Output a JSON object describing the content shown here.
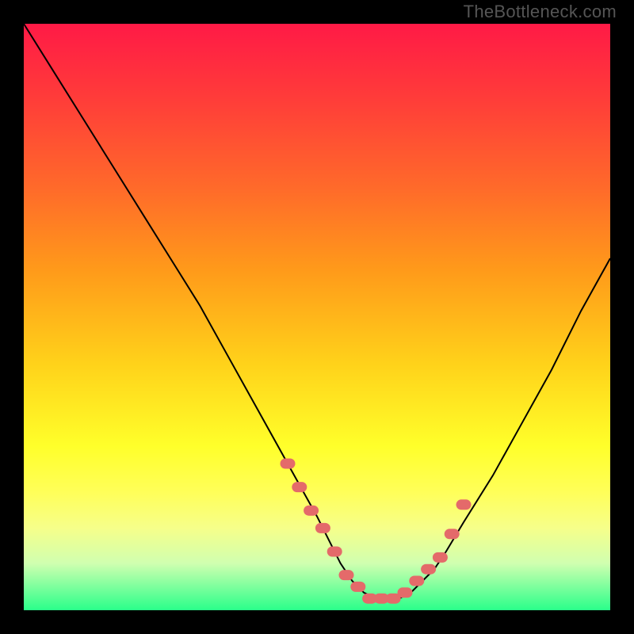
{
  "watermark": "TheBottleneck.com",
  "colors": {
    "background": "#000000",
    "gradient_top": "#ff1a46",
    "gradient_bottom": "#2aff8a",
    "curve": "#000000",
    "marker": "#e46a6a"
  },
  "chart_data": {
    "type": "line",
    "title": "",
    "xlabel": "",
    "ylabel": "",
    "xlim": [
      0,
      100
    ],
    "ylim": [
      0,
      100
    ],
    "grid": false,
    "legend": false,
    "series": [
      {
        "name": "bottleneck-curve",
        "x": [
          0,
          5,
          10,
          15,
          20,
          25,
          30,
          35,
          40,
          45,
          50,
          52,
          54,
          56,
          58,
          60,
          62,
          64,
          66,
          68,
          70,
          72,
          75,
          80,
          85,
          90,
          95,
          100
        ],
        "values": [
          100,
          92,
          84,
          76,
          68,
          60,
          52,
          43,
          34,
          25,
          16,
          12,
          8,
          5,
          3,
          2,
          2,
          2,
          3,
          5,
          7,
          10,
          15,
          23,
          32,
          41,
          51,
          60
        ]
      }
    ],
    "markers": {
      "name": "highlight-dots",
      "x": [
        45,
        47,
        49,
        51,
        53,
        55,
        57,
        59,
        61,
        63,
        65,
        67,
        69,
        71,
        73,
        75
      ],
      "values": [
        25,
        21,
        17,
        14,
        10,
        6,
        4,
        2,
        2,
        2,
        3,
        5,
        7,
        9,
        13,
        18
      ]
    }
  }
}
